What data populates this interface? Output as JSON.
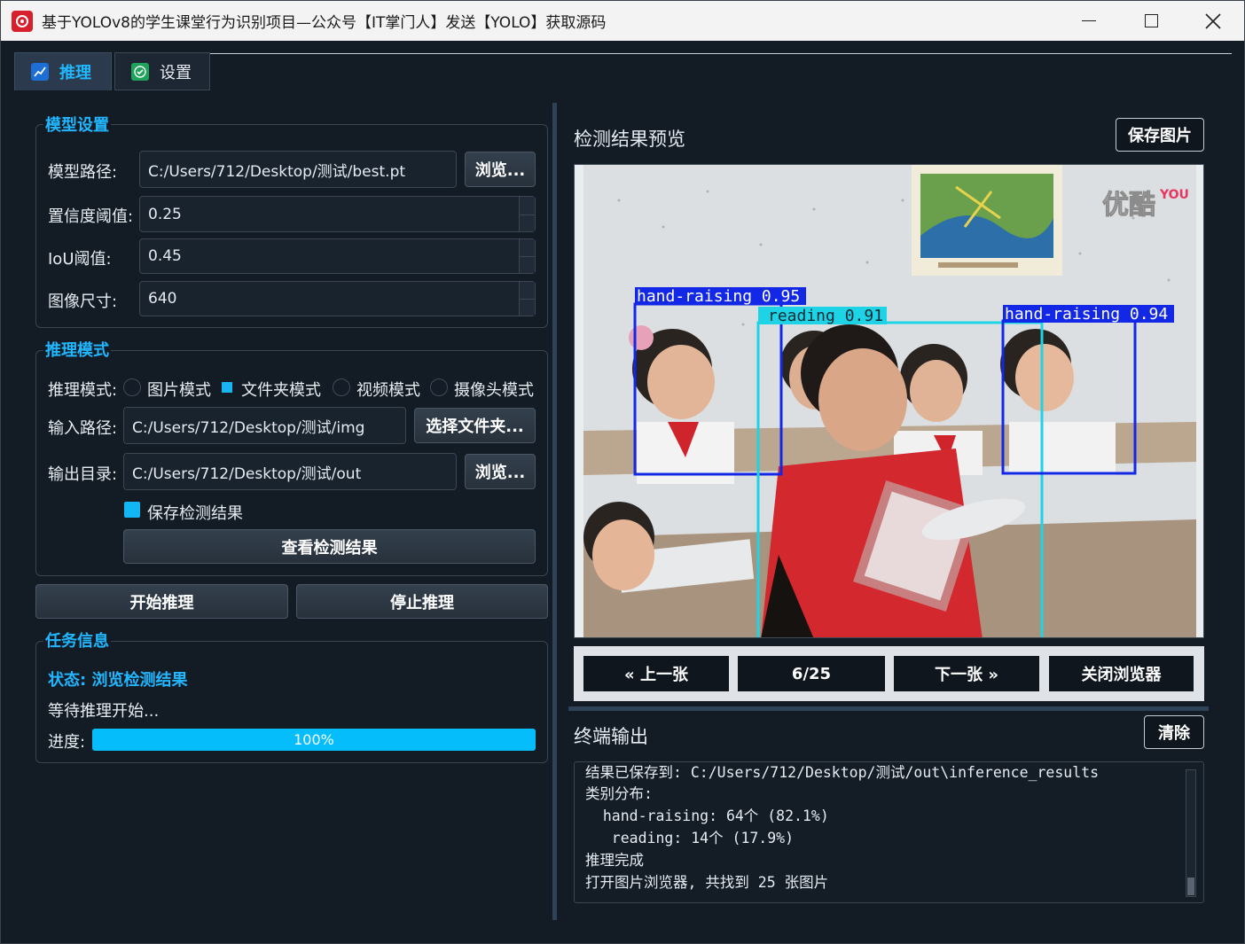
{
  "window": {
    "title": "基于YOLOv8的学生课堂行为识别项目—公众号【IT掌门人】发送【YOLO】获取源码"
  },
  "tabs": [
    {
      "label": "推理",
      "icon": "chart-icon",
      "active": true
    },
    {
      "label": "设置",
      "icon": "check-icon",
      "active": false
    }
  ],
  "model_settings": {
    "title": "模型设置",
    "model_path_label": "模型路径:",
    "model_path_value": "C:/Users/712/Desktop/测试/best.pt",
    "browse_label": "浏览...",
    "conf_label": "置信度阈值:",
    "conf_value": "0.25",
    "iou_label": "IoU阈值:",
    "iou_value": "0.45",
    "imgsz_label": "图像尺寸:",
    "imgsz_value": "640"
  },
  "inference_mode": {
    "title": "推理模式",
    "mode_label": "推理模式:",
    "modes": [
      "图片模式",
      "文件夹模式",
      "视频模式",
      "摄像头模式"
    ],
    "selected_mode": "文件夹模式",
    "input_label": "输入路径:",
    "input_value": "C:/Users/712/Desktop/测试/img",
    "select_folder_label": "选择文件夹...",
    "output_label": "输出目录:",
    "output_value": "C:/Users/712/Desktop/测试/out",
    "browse_label": "浏览...",
    "save_results_label": "保存检测结果",
    "save_results_checked": true,
    "view_results_label": "查看检测结果"
  },
  "actions": {
    "start_label": "开始推理",
    "stop_label": "停止推理"
  },
  "task_info": {
    "title": "任务信息",
    "status": "状态: 浏览检测结果",
    "message": "等待推理开始...",
    "progress_label": "进度:",
    "progress_value": 1.0,
    "progress_text": "100%"
  },
  "preview": {
    "title": "检测结果预览",
    "save_image_label": "保存图片",
    "watermark": "优酷",
    "watermark_brand": "YOU",
    "detections": [
      {
        "label": "hand-raising 0.95",
        "color": "#1228e6"
      },
      {
        "label": "reading 0.91",
        "color": "#1fd3e6"
      },
      {
        "label": "hand-raising 0.94",
        "color": "#1228e6"
      }
    ]
  },
  "browser_nav": {
    "prev_label": "« 上一张",
    "counter": "6/25",
    "next_label": "下一张 »",
    "close_label": "关闭浏览器"
  },
  "terminal": {
    "title": "终端输出",
    "clear_label": "清除",
    "lines": [
      "结果已保存到: C:/Users/712/Desktop/测试/out\\inference_results",
      "类别分布:",
      "  hand-raising: 64个 (82.1%)",
      "   reading: 14个 (17.9%)",
      "推理完成",
      "打开图片浏览器, 共找到 25 张图片"
    ]
  },
  "colors": {
    "accent": "#22b6ff",
    "background": "#131b24",
    "progress": "#06bdfb"
  }
}
